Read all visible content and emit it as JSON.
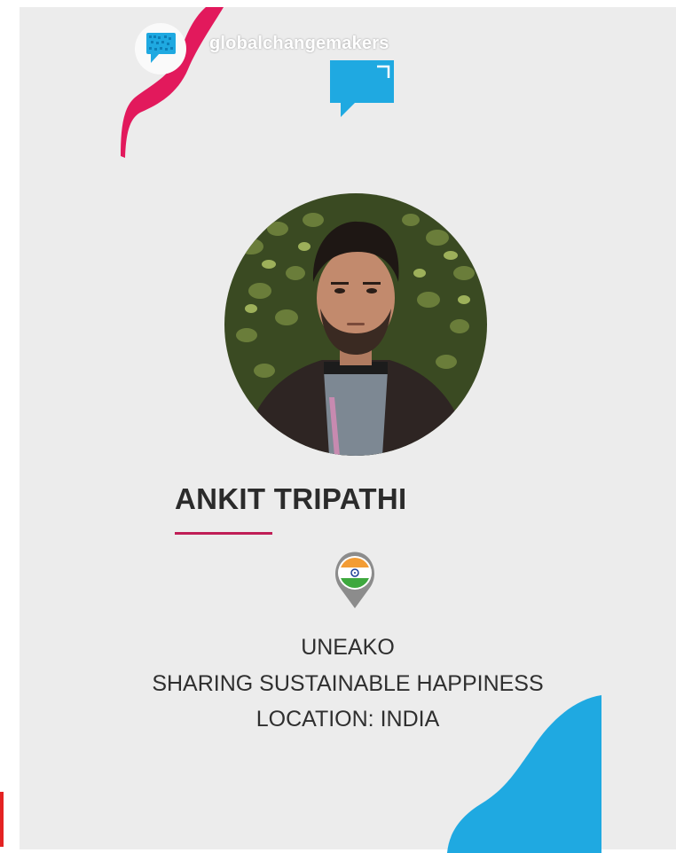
{
  "brand": {
    "handle": "globalchangemakers"
  },
  "profile": {
    "name": "ANKIT TRIPATHI",
    "organization": "UNEAKO",
    "tagline": "SHARING SUSTAINABLE HAPPINESS",
    "location": "LOCATION: INDIA"
  },
  "colors": {
    "background": "#ececec",
    "accent_pink": "#e2195c",
    "accent_blue": "#1fa9e1",
    "text_dark": "#2b2b2b"
  },
  "icons": {
    "logo": "chat-bubble-logo-icon",
    "decoration": "speech-bubble-icon",
    "location": "india-flag-pin-icon"
  }
}
